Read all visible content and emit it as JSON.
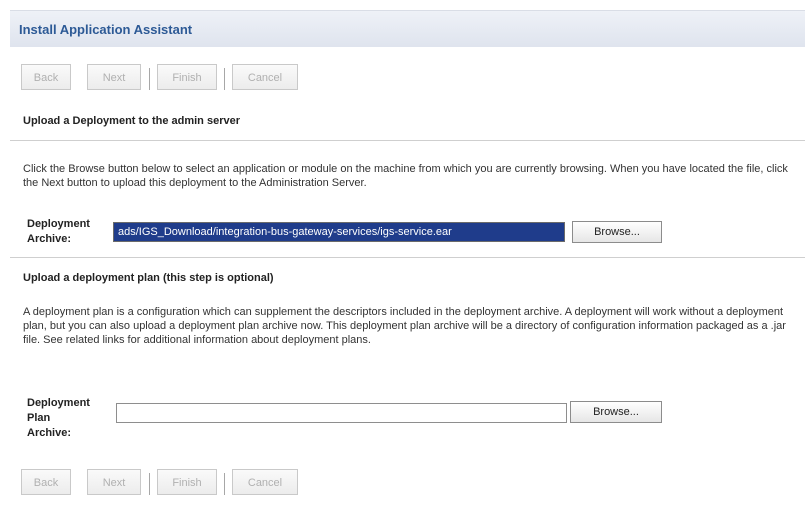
{
  "header": {
    "title": "Install Application Assistant"
  },
  "buttons_top": {
    "back": "Back",
    "next": "Next",
    "finish": "Finish",
    "cancel": "Cancel"
  },
  "section1": {
    "title": "Upload a Deployment to the admin server",
    "description": "Click the Browse button below to select an application or module on the machine from which you are currently browsing. When you have located the file, click the Next button to upload this deployment to the Administration Server.",
    "archive_label_1": "Deployment",
    "archive_label_2": "Archive:",
    "archive_value": "ads/IGS_Download/integration-bus-gateway-services/igs-service.ear",
    "browse_label": "Browse..."
  },
  "section2": {
    "title": "Upload a deployment plan (this step is optional)",
    "description": "A deployment plan is a configuration which can supplement the descriptors included in the deployment archive. A deployment will work without a deployment plan, but you can also upload a deployment plan archive now. This deployment plan archive will be a directory of configuration information packaged as a .jar file. See related links for additional information about deployment plans.",
    "plan_label_1": "Deployment",
    "plan_label_2": "Plan",
    "plan_label_3": "Archive:",
    "plan_value": "",
    "browse_label": "Browse..."
  },
  "buttons_bottom": {
    "back": "Back",
    "next": "Next",
    "finish": "Finish",
    "cancel": "Cancel"
  }
}
